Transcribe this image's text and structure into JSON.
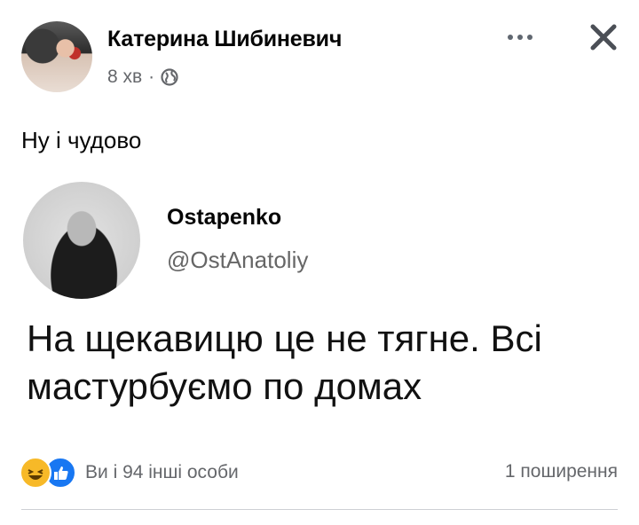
{
  "post": {
    "author": "Катерина Шибиневич",
    "time": "8 хв",
    "separator": "·",
    "privacy_icon": "globe-icon",
    "text": "Ну і чудово"
  },
  "header_actions": {
    "more_icon": "more-dots-icon",
    "close_icon": "close-icon"
  },
  "tweet": {
    "name": "Ostapenko",
    "handle": "@OstAnatoliy",
    "text": "На щекавицю це не тягне. Всі мастурбуємо по домах"
  },
  "footer": {
    "reaction_icons": [
      "haha-icon",
      "like-icon"
    ],
    "reactions_text": "Ви і 94 інші особи",
    "shares_text": "1 поширення"
  },
  "colors": {
    "secondary_text": "#65676b",
    "like_blue": "#1877f2",
    "haha_yellow": "#f7b928"
  }
}
